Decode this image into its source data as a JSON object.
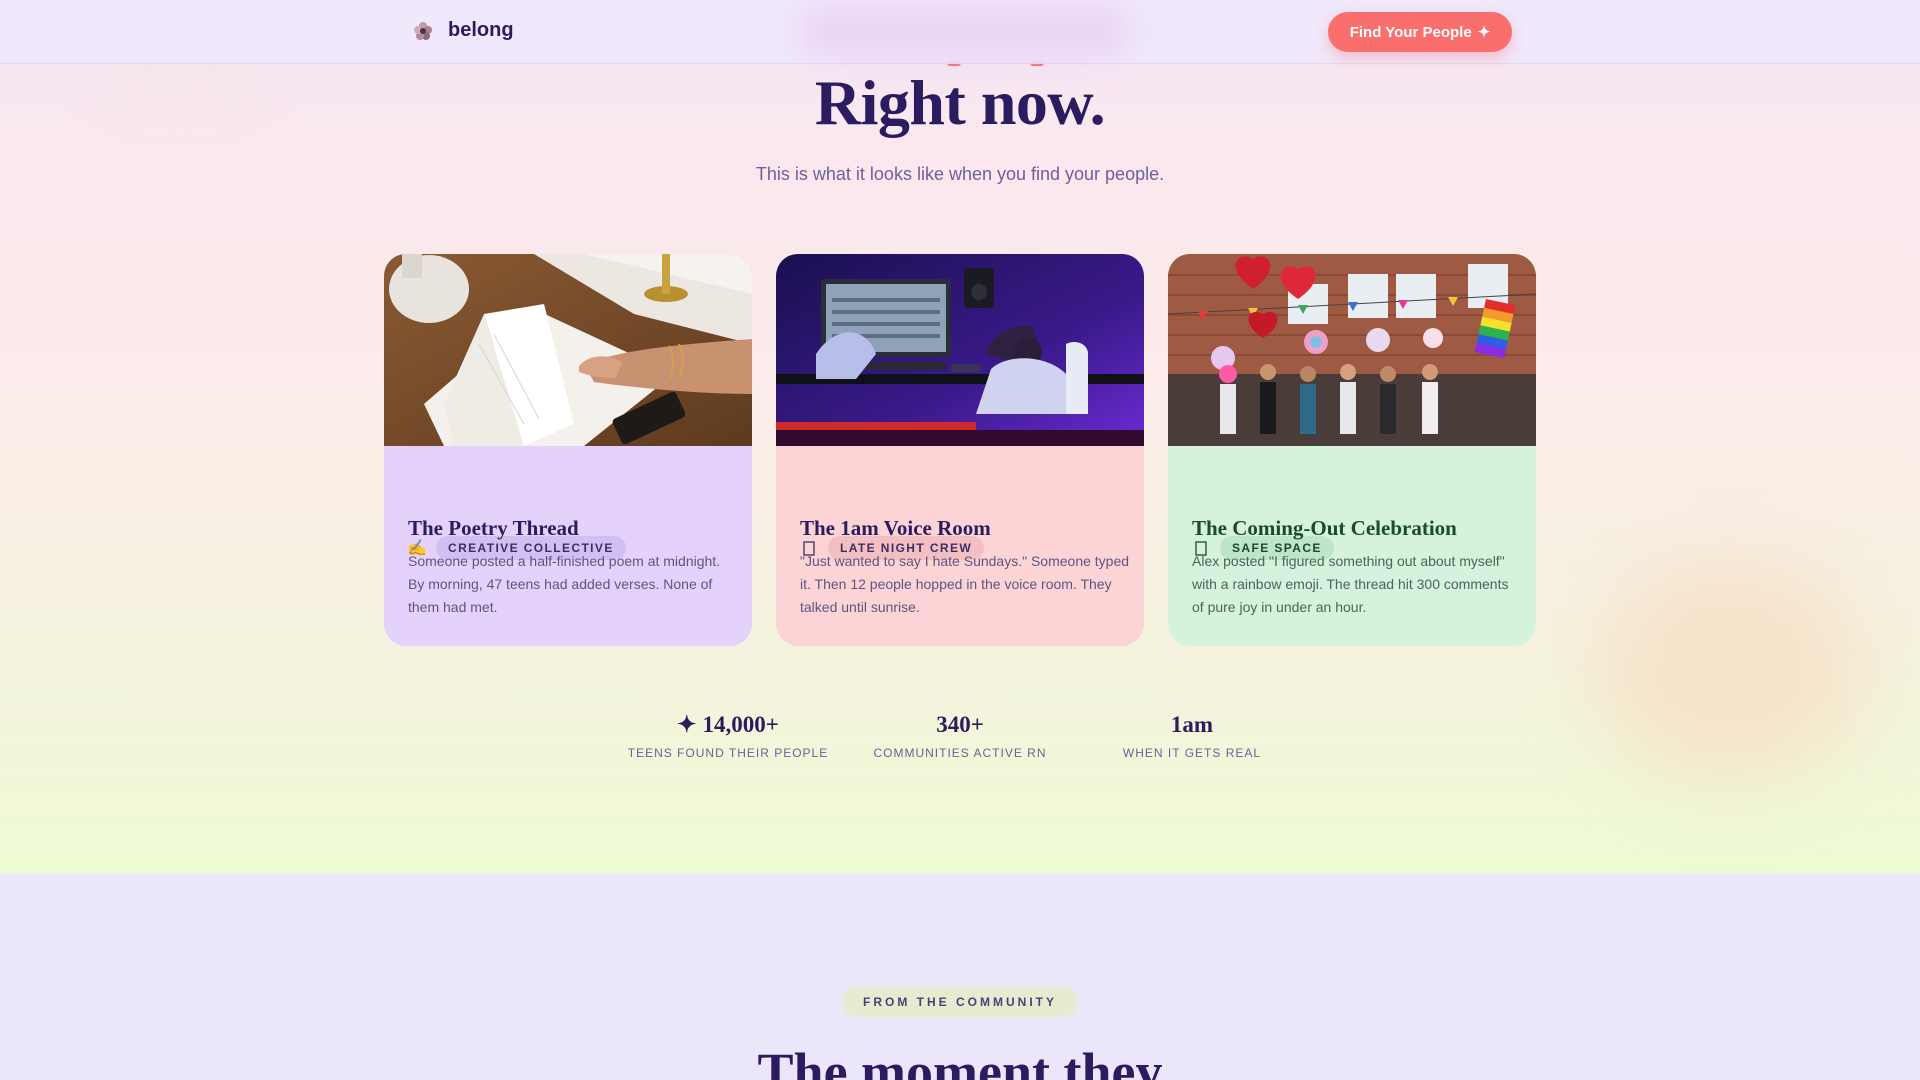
{
  "nav": {
    "brand": "belong",
    "cta_label": "Find Your People",
    "cta_icon": "sparkle-icon"
  },
  "hero": {
    "title": "Right now.",
    "subtitle": "This is what it looks like when you find your people."
  },
  "cards": [
    {
      "icon": "writing-hand-icon",
      "badge": "CREATIVE COLLECTIVE",
      "title": "The Poetry Thread",
      "description": "Someone posted a half-finished poem at midnight. By morning, 47 teens had added verses. None of them had met.",
      "accent": "#e4d2fb"
    },
    {
      "icon": "moon-icon",
      "badge": "LATE NIGHT CREW",
      "title": "The 1am Voice Room",
      "description": "\"Just wanted to say I hate Sundays.\" Someone typed it. Then 12 people hopped in the voice room. They talked until sunrise.",
      "accent": "#fcd4d6"
    },
    {
      "icon": "rainbow-icon",
      "badge": "SAFE SPACE",
      "title": "The Coming-Out Celebration",
      "description": "Alex posted \"I figured something out about myself\" with a rainbow emoji. The thread hit 300 comments of pure joy in under an hour.",
      "accent": "#d4f2dc"
    }
  ],
  "stats": [
    {
      "value": "14,000+",
      "label": "TEENS FOUND THEIR PEOPLE",
      "icon": "sparkle-icon"
    },
    {
      "value": "340+",
      "label": "COMMUNITIES ACTIVE RN"
    },
    {
      "value": "1am",
      "label": "WHEN IT GETS REAL"
    }
  ],
  "community": {
    "eyebrow": "FROM THE COMMUNITY",
    "heading": "The moment they"
  },
  "colors": {
    "brand_navy": "#2a1c5e",
    "cta_coral": "#fb6e6e",
    "muted_purple": "#6d5f9c"
  }
}
